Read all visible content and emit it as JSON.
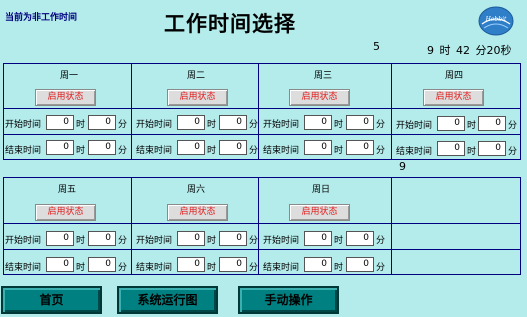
{
  "status_text": "当前为非工作时间",
  "title": "工作时间选择",
  "indicator_top": "5",
  "clock": {
    "hour": "9",
    "hour_unit": "时",
    "minute": "42",
    "minute_unit": "分",
    "second": "20",
    "second_unit": "秒"
  },
  "indicator_mid": "9",
  "labels": {
    "start": "开始时间",
    "end": "结束时间",
    "hour": "时",
    "minute": "分"
  },
  "days": [
    {
      "name": "周一",
      "button": "启用状态",
      "start_hour": "0",
      "start_min": "0",
      "end_hour": "0",
      "end_min": "0"
    },
    {
      "name": "周二",
      "button": "启用状态",
      "start_hour": "0",
      "start_min": "0",
      "end_hour": "0",
      "end_min": "0"
    },
    {
      "name": "周三",
      "button": "启用状态",
      "start_hour": "0",
      "start_min": "0",
      "end_hour": "0",
      "end_min": "0"
    },
    {
      "name": "周四",
      "button": "启用状态",
      "start_hour": "0",
      "start_min": "0",
      "end_hour": "0",
      "end_min": "0"
    },
    {
      "name": "周五",
      "button": "启用状态",
      "start_hour": "0",
      "start_min": "0",
      "end_hour": "0",
      "end_min": "0"
    },
    {
      "name": "周六",
      "button": "启用状态",
      "start_hour": "0",
      "start_min": "0",
      "end_hour": "0",
      "end_min": "0"
    },
    {
      "name": "周日",
      "button": "启用状态",
      "start_hour": "0",
      "start_min": "0",
      "end_hour": "0",
      "end_min": "0"
    }
  ],
  "nav": {
    "home": "首页",
    "system_diagram": "系统运行图",
    "manual": "手动操作"
  },
  "colors": {
    "background": "#b4ebeb",
    "grid_line": "#000080",
    "button_text": "#e02020",
    "nav_button": "#008080"
  }
}
